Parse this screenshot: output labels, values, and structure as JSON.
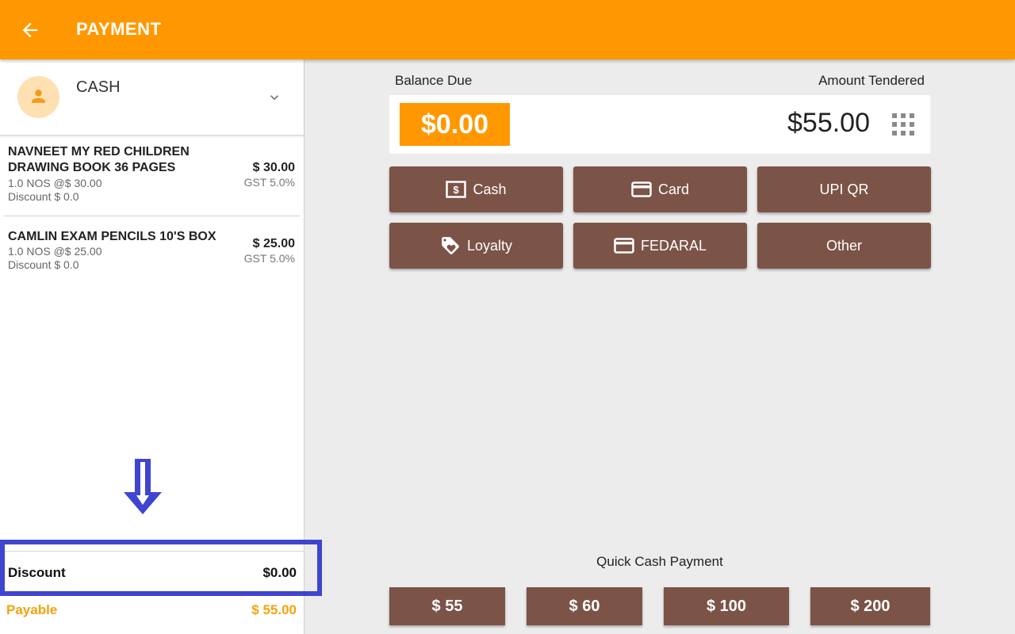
{
  "header": {
    "title": "PAYMENT",
    "back_icon": "arrow-left-icon",
    "color": "#ff9800"
  },
  "customer": {
    "name": "CASH",
    "avatar_icon": "person-icon",
    "dropdown_icon": "chevron-down-icon"
  },
  "items": [
    {
      "name": "NAVNEET MY RED CHILDREN DRAWING BOOK 36 PAGES",
      "qty_line": "1.0 NOS @$ 30.00",
      "discount_line": "Discount $ 0.0",
      "price": "$ 30.00",
      "tax": "GST 5.0%"
    },
    {
      "name": "CAMLIN EXAM PENCILS 10'S BOX",
      "qty_line": "1.0 NOS @$ 25.00",
      "discount_line": "Discount $ 0.0",
      "price": "$ 25.00",
      "tax": "GST 5.0%"
    }
  ],
  "summary": {
    "discount_label": "Discount",
    "discount_value": "$0.00",
    "payable_label": "Payable",
    "payable_value": "$ 55.00",
    "highlight_color": "#3f45cf",
    "payable_color": "#f5a20a"
  },
  "balance": {
    "label": "Balance Due",
    "value": "$0.00",
    "tendered_label": "Amount Tendered",
    "tendered_value": "$55.00",
    "keypad_icon": "grid-keypad-icon"
  },
  "payment_methods": [
    {
      "label": "Cash",
      "icon": "cash-icon"
    },
    {
      "label": "Card",
      "icon": "credit-card-icon"
    },
    {
      "label": "UPI QR",
      "icon": ""
    },
    {
      "label": "Loyalty",
      "icon": "loyalty-tag-icon"
    },
    {
      "label": "FEDARAL",
      "icon": "credit-card-icon"
    },
    {
      "label": "Other",
      "icon": ""
    }
  ],
  "button_color": "#7b5347",
  "quick_cash": {
    "label": "Quick Cash Payment",
    "amounts": [
      "$ 55",
      "$ 60",
      "$ 100",
      "$ 200"
    ]
  }
}
